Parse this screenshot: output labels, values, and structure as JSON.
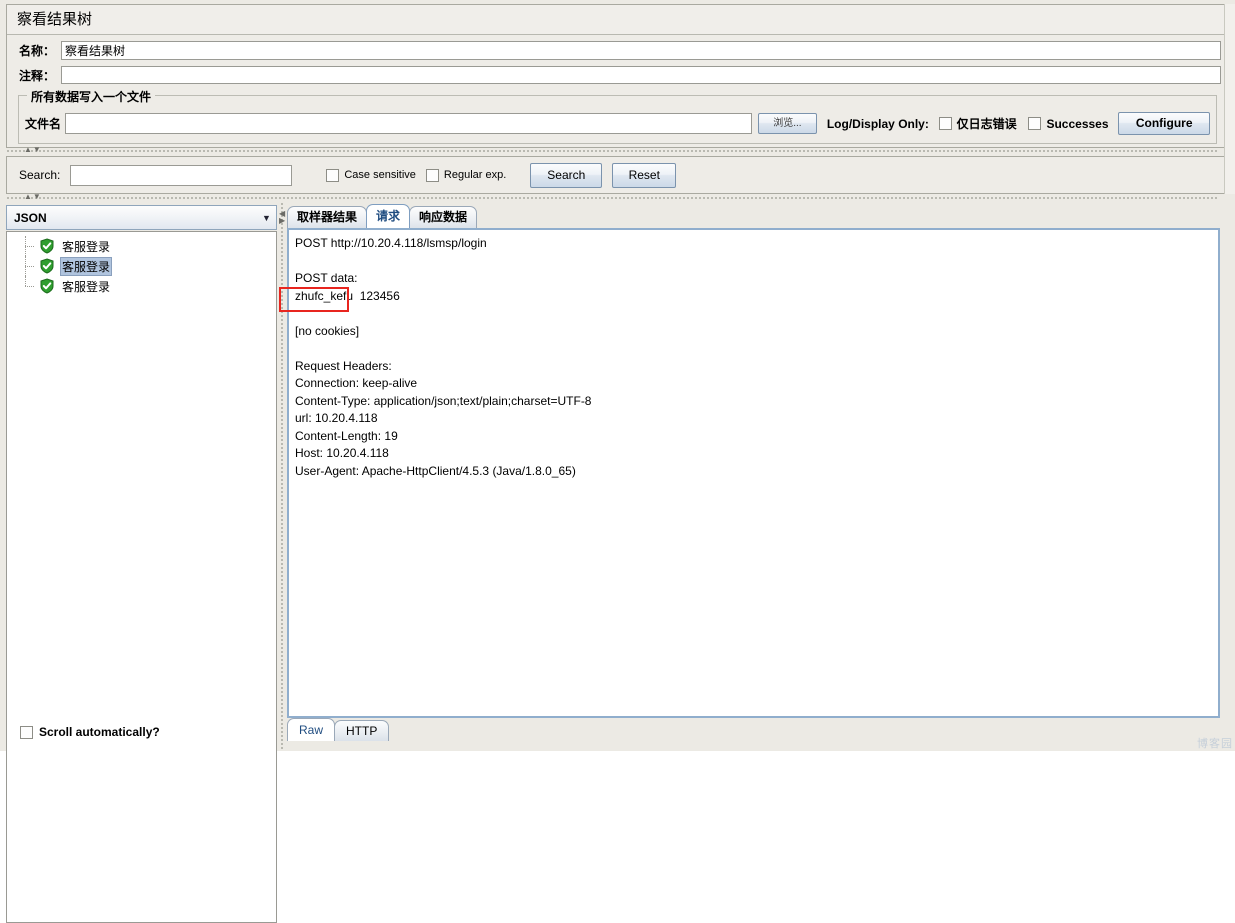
{
  "window": {
    "title": "察看结果树"
  },
  "form": {
    "name_label": "名称：",
    "name_value": "察看结果树",
    "comment_label": "注释：",
    "comment_value": "",
    "group_legend": "所有数据写入一个文件",
    "filename_label": "文件名",
    "filename_value": "",
    "browse_button": "浏览...",
    "log_display_label": "Log/Display Only:",
    "errors_checkbox": "仅日志错误",
    "successes_checkbox": "Successes",
    "configure_button": "Configure"
  },
  "search": {
    "label": "Search:",
    "value": "",
    "case_sensitive": "Case sensitive",
    "regular_exp": "Regular exp.",
    "search_button": "Search",
    "reset_button": "Reset"
  },
  "left": {
    "renderer_selected": "JSON",
    "tree_items": [
      {
        "label": "客服登录",
        "selected": false
      },
      {
        "label": "客服登录",
        "selected": true
      },
      {
        "label": "客服登录",
        "selected": false
      }
    ],
    "scroll_automatically": "Scroll automatically?"
  },
  "right": {
    "tabs": [
      {
        "label": "取样器结果",
        "active": false
      },
      {
        "label": "请求",
        "active": true
      },
      {
        "label": "响应数据",
        "active": false
      }
    ],
    "bottom_tabs": [
      {
        "label": "Raw",
        "active": true
      },
      {
        "label": "HTTP",
        "active": false
      }
    ],
    "request_text": "POST http://10.20.4.118/lsmsp/login\n\nPOST data:\nzhufc_kefu  123456\n\n[no cookies]\n\nRequest Headers:\nConnection: keep-alive\nContent-Type: application/json;text/plain;charset=UTF-8\nurl: 10.20.4.118\nContent-Length: 19\nHost: 10.20.4.118\nUser-Agent: Apache-HttpClient/4.5.3 (Java/1.8.0_65)"
  },
  "watermark": "博客园"
}
